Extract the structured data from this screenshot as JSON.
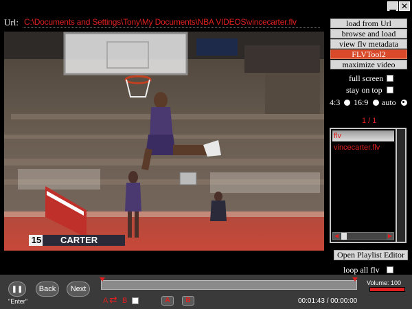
{
  "window": {
    "minimize_icon": "minimize-icon",
    "close_icon": "close-icon"
  },
  "url": {
    "label": "Url:",
    "value": "C:\\Documents and Settings\\Tony\\My Documents\\NBA VIDEOS\\vincecarter.flv"
  },
  "video": {
    "player_name": "CARTER",
    "player_number": "15"
  },
  "side_buttons": [
    {
      "label": "load from Url",
      "active": false
    },
    {
      "label": "browse and load",
      "active": false
    },
    {
      "label": "view flv metadata",
      "active": false
    },
    {
      "label": "FLVTool2",
      "active": true
    },
    {
      "label": "maximize video",
      "active": false
    }
  ],
  "options": {
    "full_screen": "full screen",
    "stay_on_top": "stay on top",
    "ratio_43": "4:3",
    "ratio_169": "16:9",
    "ratio_auto": "auto",
    "selected_ratio": "auto"
  },
  "playlist": {
    "counter": "1 / 1",
    "header": "flv",
    "items": [
      "vincecarter.flv"
    ],
    "open_editor": "Open Playlist Editor",
    "loop_all": "loop all flv"
  },
  "controls": {
    "pause_icon": "pause-icon",
    "back": "Back",
    "next": "Next",
    "hint": "\"Enter\"",
    "a_label": "A",
    "b_label": "B",
    "a_button": "A",
    "b_button": "B",
    "time": "00:01:43 / 00:00:00",
    "volume_label": "Volume: 100"
  },
  "colors": {
    "accent": "#e02020",
    "active_button": "#d84a2a",
    "bar": "#3a3a3a"
  }
}
